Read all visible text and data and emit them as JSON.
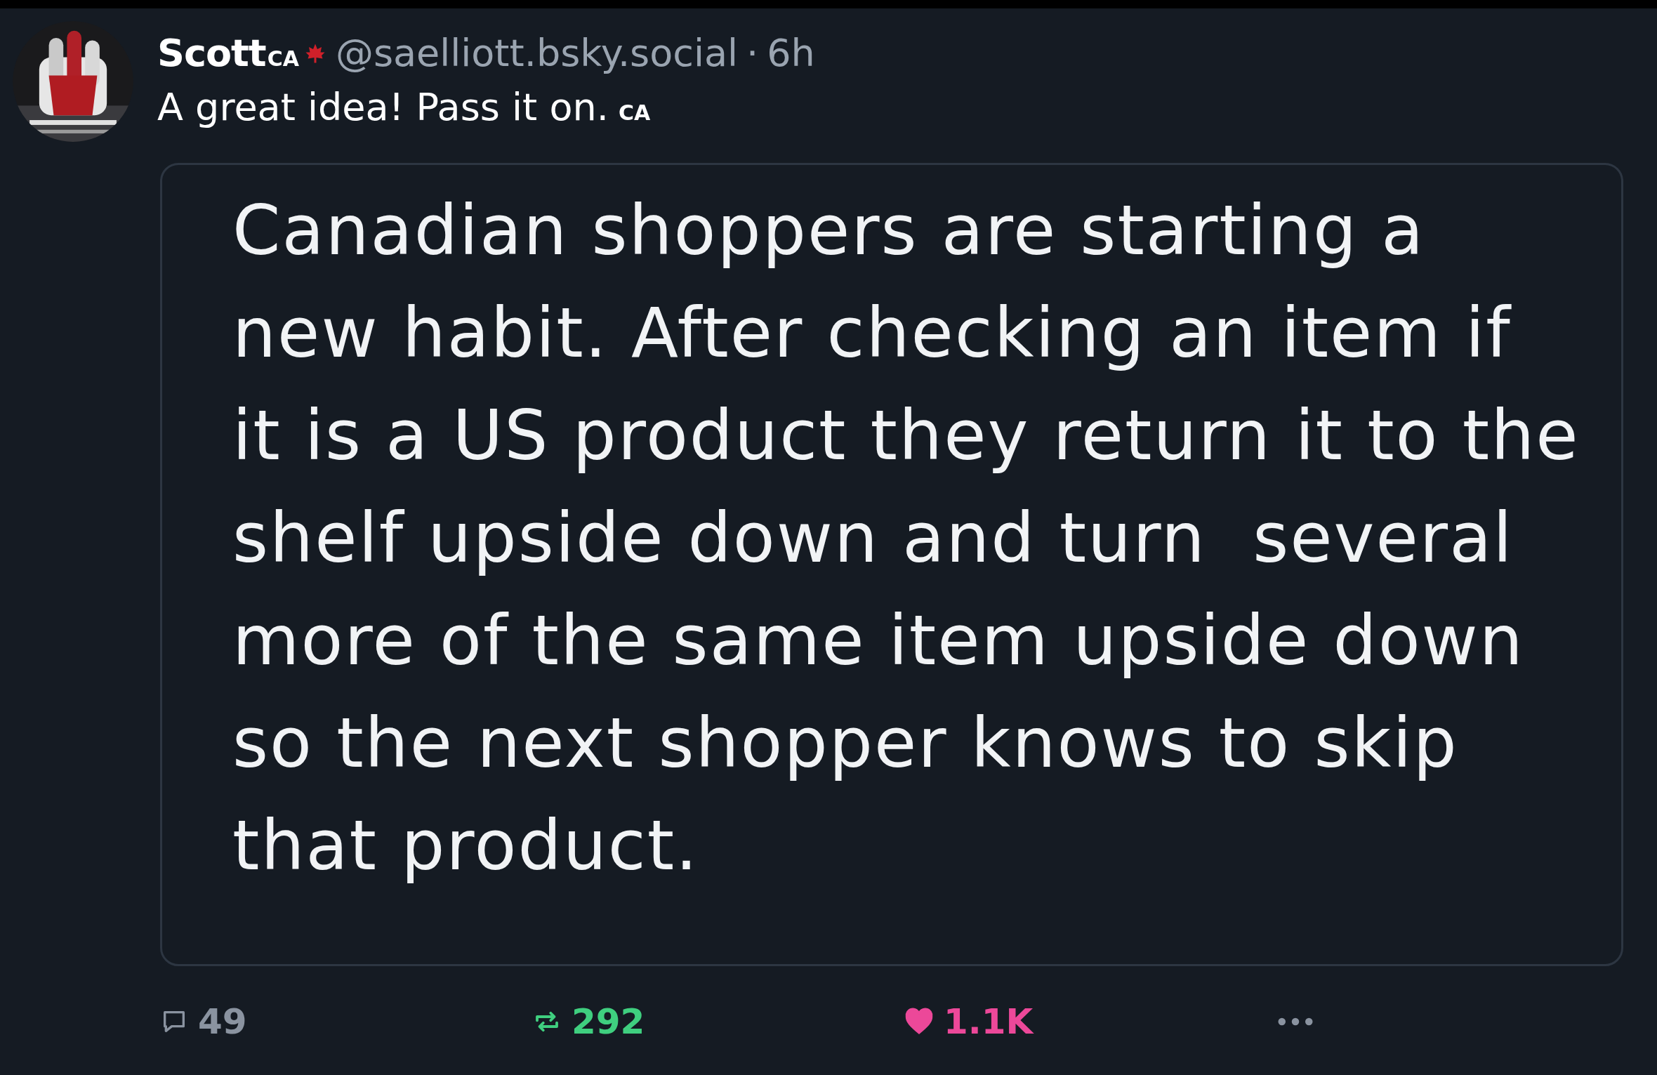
{
  "post": {
    "author": {
      "name": "Scott",
      "name_tag": "CA",
      "handle": "@saelliott.bsky.social",
      "separator": "·",
      "time": "6h"
    },
    "text": "A great idea! Pass it on.",
    "text_tag": "CA",
    "quote": {
      "text": "Canadian shoppers are starting a\nnew habit. After checking an item if\nit is a US product they return it to the\nshelf upside down and turn  several\nmore of the same item upside down\nso the next shopper knows to skip\nthat product."
    },
    "actions": [
      {
        "kind": "reply",
        "count": "49"
      },
      {
        "kind": "repost",
        "count": "292",
        "on": true
      },
      {
        "kind": "like",
        "count": "1.1K",
        "on": true
      },
      {
        "kind": "more"
      }
    ]
  }
}
